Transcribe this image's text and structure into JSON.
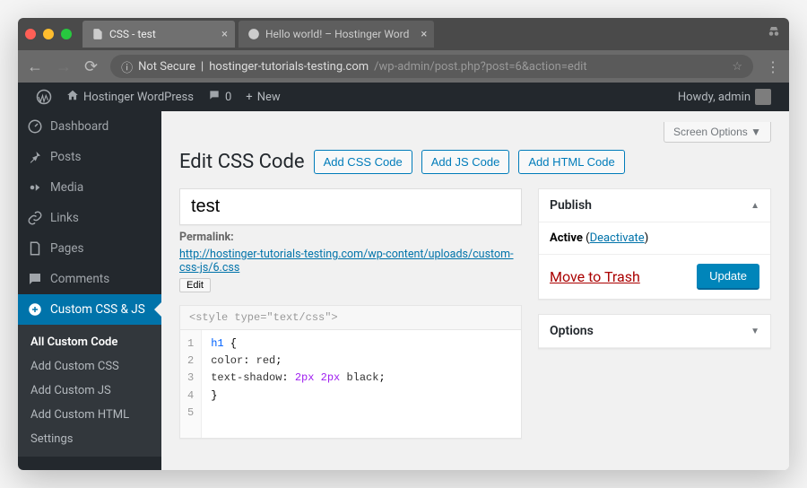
{
  "browser": {
    "tabs": [
      {
        "label": "CSS - test",
        "active": true
      },
      {
        "label": "Hello world! – Hostinger Word",
        "active": false
      }
    ],
    "url": {
      "secure_label": "Not Secure",
      "host": "hostinger-tutorials-testing.com",
      "path": "/wp-admin/post.php?post=6&action=edit"
    }
  },
  "adminbar": {
    "site_name": "Hostinger WordPress",
    "comments_count": "0",
    "new_label": "New",
    "howdy": "Howdy, admin"
  },
  "sidebar": {
    "items": [
      {
        "icon": "dashboard",
        "label": "Dashboard"
      },
      {
        "icon": "pin",
        "label": "Posts"
      },
      {
        "icon": "media",
        "label": "Media"
      },
      {
        "icon": "link",
        "label": "Links"
      },
      {
        "icon": "page",
        "label": "Pages"
      },
      {
        "icon": "comment",
        "label": "Comments"
      },
      {
        "icon": "plus",
        "label": "Custom CSS & JS",
        "current": true
      }
    ],
    "subitems": [
      {
        "label": "All Custom Code",
        "active": true
      },
      {
        "label": "Add Custom CSS"
      },
      {
        "label": "Add Custom JS"
      },
      {
        "label": "Add Custom HTML"
      },
      {
        "label": "Settings"
      }
    ]
  },
  "main": {
    "screen_options": "Screen Options",
    "title": "Edit CSS Code",
    "buttons": {
      "add_css": "Add CSS Code",
      "add_js": "Add JS Code",
      "add_html": "Add HTML Code"
    },
    "post_title": "test",
    "permalink": {
      "label": "Permalink:",
      "url_text": "http://hostinger-tutorials-testing.com/wp-content/uploads/custom-css-js/6.css",
      "edit": "Edit"
    },
    "editor": {
      "header": "<style type=\"text/css\">",
      "lines": [
        "1",
        "2",
        "3",
        "4",
        "5"
      ],
      "code": {
        "l1_sel": "h1",
        "l1_brace": " {",
        "l2_prop": "    color",
        "l2_val": "red",
        "l3_prop": "    text-shadow",
        "l3_num1": "2px",
        "l3_num2": "2px",
        "l3_val": "black",
        "l4": "}"
      }
    }
  },
  "side": {
    "publish": {
      "title": "Publish",
      "status_label": "Active",
      "deactivate": "Deactivate",
      "trash": "Move to Trash",
      "update": "Update"
    },
    "options": {
      "title": "Options"
    }
  }
}
